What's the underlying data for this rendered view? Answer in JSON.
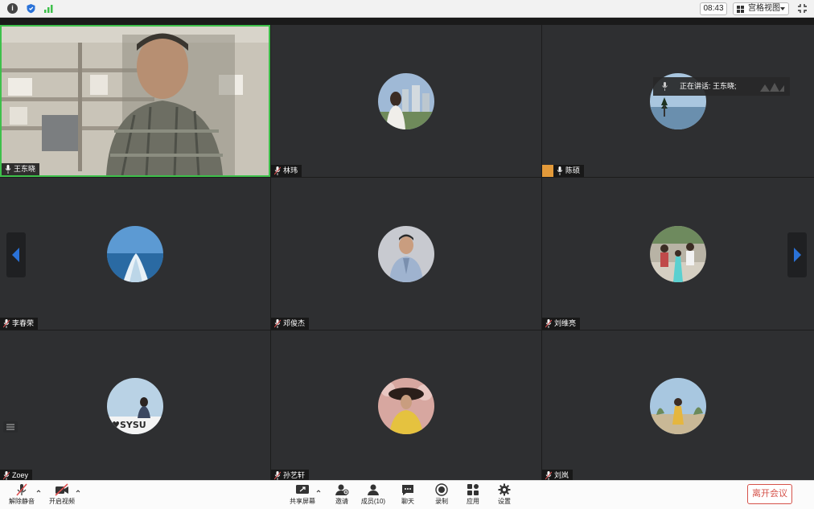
{
  "top_bar": {
    "clock": "08:43",
    "view_mode": "宫格视图",
    "icons": [
      "info-icon",
      "shield-icon",
      "signal-icon",
      "exit-fullscreen-icon"
    ]
  },
  "participants": [
    {
      "name": "王东晓",
      "active": true,
      "video": true
    },
    {
      "name": "林玮"
    },
    {
      "name": "陈硕",
      "host": true
    },
    {
      "name": "李春荣"
    },
    {
      "name": "邓俊杰"
    },
    {
      "name": "刘维亮"
    },
    {
      "name": "Zoey"
    },
    {
      "name": "孙艺轩"
    },
    {
      "name": "刘岚"
    }
  ],
  "speaking": {
    "label": "正在讲话: 王东晓;"
  },
  "toolbar": {
    "unmute": "解除静音",
    "start_video": "开启视频",
    "share_screen": "共享屏幕",
    "invite": "邀请",
    "members": "成员(10)",
    "chat": "聊天",
    "record": "录制",
    "apps": "应用",
    "settings": "设置",
    "leave": "离开会议"
  },
  "colors": {
    "active_border": "#3ec04b",
    "leave": "#d5524a",
    "nav_arrow": "#2a72d8"
  }
}
